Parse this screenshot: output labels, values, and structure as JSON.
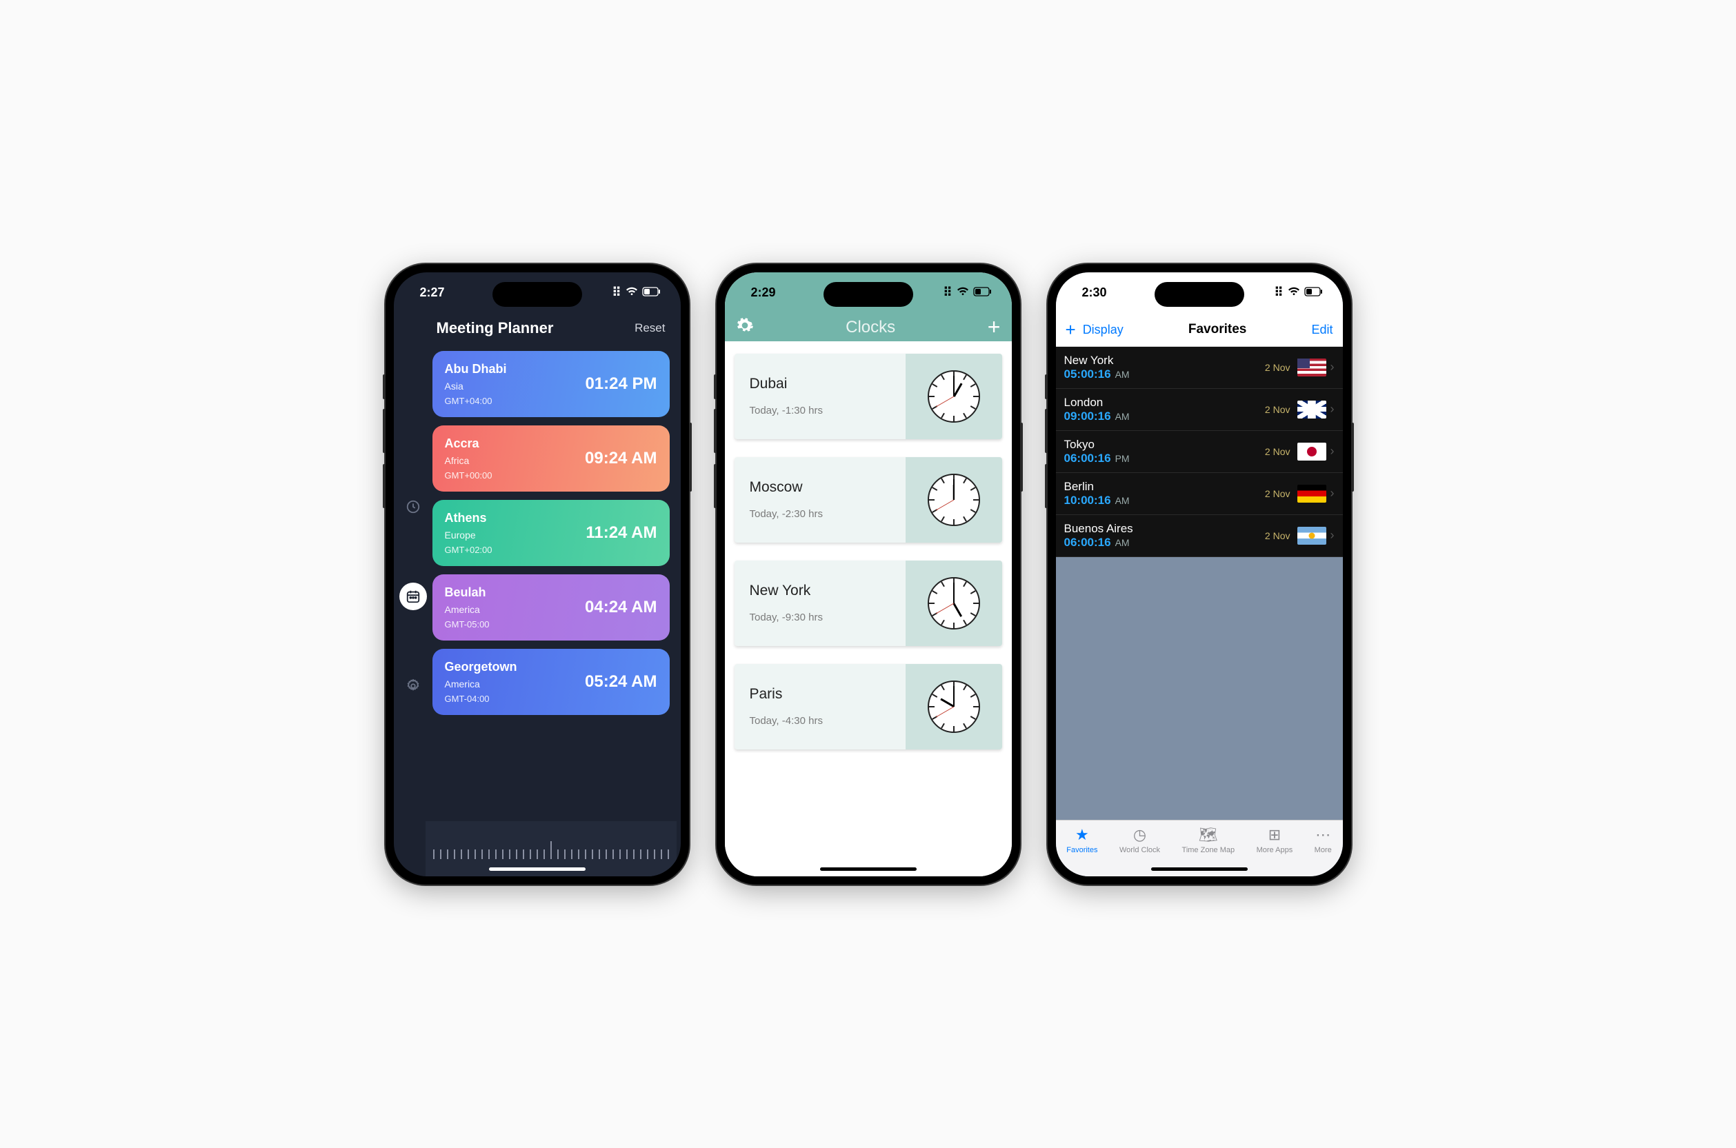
{
  "phone1": {
    "status_time": "2:27",
    "title": "Meeting Planner",
    "reset_label": "Reset",
    "sidebar": [
      {
        "icon": "clock-icon",
        "active": false
      },
      {
        "icon": "calendar-icon",
        "active": true
      },
      {
        "icon": "gear-icon",
        "active": false
      }
    ],
    "cards": [
      {
        "city": "Abu Dhabi",
        "region": "Asia",
        "gmt": "GMT+04:00",
        "time": "01:24 PM",
        "gradient": "linear-gradient(100deg,#5b77ef,#5aa2f3)"
      },
      {
        "city": "Accra",
        "region": "Africa",
        "gmt": "GMT+00:00",
        "time": "09:24 AM",
        "gradient": "linear-gradient(100deg,#f46a6a,#f7a27a)"
      },
      {
        "city": "Athens",
        "region": "Europe",
        "gmt": "GMT+02:00",
        "time": "11:24 AM",
        "gradient": "linear-gradient(100deg,#2fc39b,#5bd3a5)"
      },
      {
        "city": "Beulah",
        "region": "America",
        "gmt": "GMT-05:00",
        "time": "04:24 AM",
        "gradient": "linear-gradient(100deg,#b06fe0,#a87fe6)"
      },
      {
        "city": "Georgetown",
        "region": "America",
        "gmt": "GMT-04:00",
        "time": "05:24 AM",
        "gradient": "linear-gradient(100deg,#4f69e8,#5a8cf3)"
      }
    ]
  },
  "phone2": {
    "status_time": "2:29",
    "nav_title": "Clocks",
    "cards": [
      {
        "city": "Dubai",
        "offset": "Today, -1:30 hrs",
        "hour": 1,
        "minute": 0,
        "second": 40
      },
      {
        "city": "Moscow",
        "offset": "Today, -2:30 hrs",
        "hour": 12,
        "minute": 0,
        "second": 40
      },
      {
        "city": "New York",
        "offset": "Today, -9:30 hrs",
        "hour": 5,
        "minute": 0,
        "second": 40
      },
      {
        "city": "Paris",
        "offset": "Today, -4:30 hrs",
        "hour": 10,
        "minute": 0,
        "second": 40
      }
    ]
  },
  "phone3": {
    "status_time": "2:30",
    "nav": {
      "display": "Display",
      "title": "Favorites",
      "edit": "Edit"
    },
    "rows": [
      {
        "city": "New York",
        "time": "05:00:16",
        "ampm": "AM",
        "date": "2 Nov",
        "flag": "flag-us"
      },
      {
        "city": "London",
        "time": "09:00:16",
        "ampm": "AM",
        "date": "2 Nov",
        "flag": "flag-uk"
      },
      {
        "city": "Tokyo",
        "time": "06:00:16",
        "ampm": "PM",
        "date": "2 Nov",
        "flag": "flag-jp"
      },
      {
        "city": "Berlin",
        "time": "10:00:16",
        "ampm": "AM",
        "date": "2 Nov",
        "flag": "flag-de"
      },
      {
        "city": "Buenos Aires",
        "time": "06:00:16",
        "ampm": "AM",
        "date": "2 Nov",
        "flag": "flag-ar"
      }
    ],
    "tabs": [
      {
        "label": "Favorites",
        "icon": "★",
        "active": true
      },
      {
        "label": "World Clock",
        "icon": "◷",
        "active": false
      },
      {
        "label": "Time Zone Map",
        "icon": "🗺",
        "active": false
      },
      {
        "label": "More Apps",
        "icon": "⊞",
        "active": false
      },
      {
        "label": "More",
        "icon": "⋯",
        "active": false
      }
    ]
  }
}
